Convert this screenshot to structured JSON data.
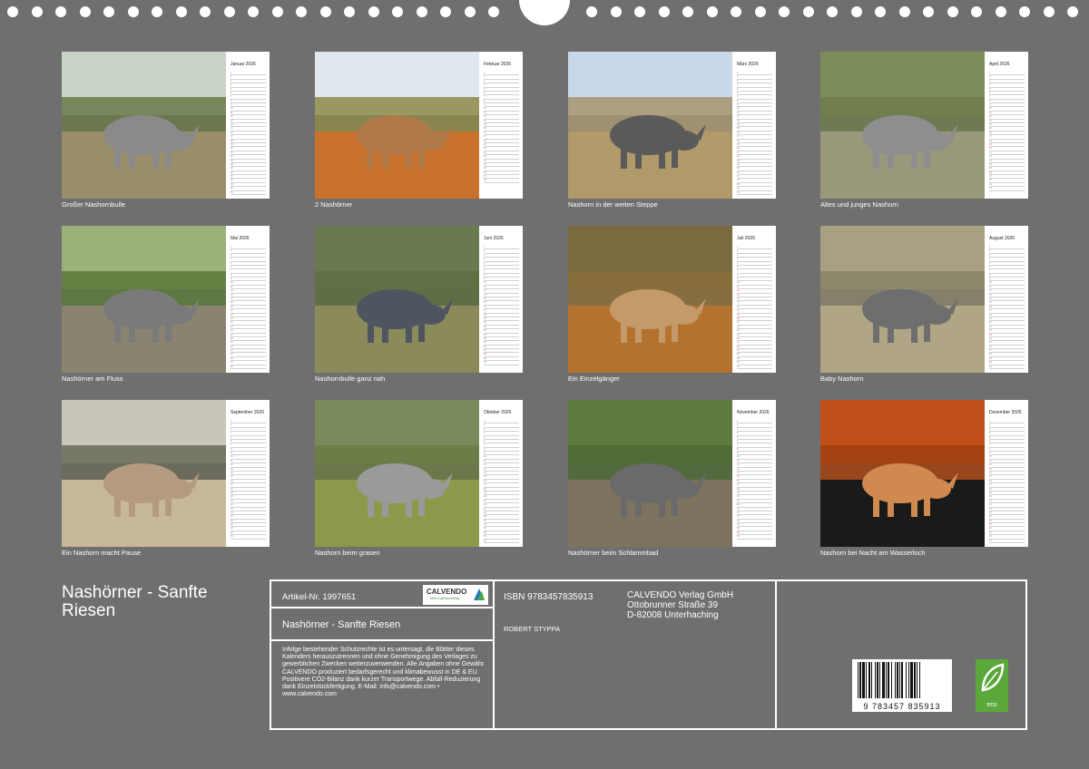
{
  "months": [
    {
      "name": "Januar 2026",
      "caption": "Großer Nashornbulle",
      "days": 31,
      "weekends": [
        4,
        11,
        18,
        25
      ],
      "sky": "#c9d2c6",
      "ground": "#9a8d6a",
      "bg": "#6b7a4a",
      "rhino": "#8a8a8a"
    },
    {
      "name": "Februar 2026",
      "caption": "2 Nashörner",
      "days": 28,
      "weekends": [
        1,
        8,
        15,
        22
      ],
      "sky": "#dfe7ee",
      "ground": "#c9722e",
      "bg": "#8d8a4a",
      "rhino": "#b0794a"
    },
    {
      "name": "März 2026",
      "caption": "Nashorn in der weiten Steppe",
      "days": 31,
      "weekends": [
        1,
        8,
        15,
        22,
        29
      ],
      "sky": "#c9d8e8",
      "ground": "#b09a6a",
      "bg": "#a89670",
      "rhino": "#5a5a5a"
    },
    {
      "name": "April 2026",
      "caption": "Altes und junges Nashorn",
      "days": 30,
      "weekends": [
        5,
        12,
        19,
        26
      ],
      "sky": "#7d8d5a",
      "ground": "#9a987a",
      "bg": "#6e7d4e",
      "rhino": "#8e8e8e"
    },
    {
      "name": "Mai 2026",
      "caption": "Nashörner am Fluss",
      "days": 31,
      "weekends": [
        3,
        10,
        17,
        24,
        31
      ],
      "sky": "#9cb07a",
      "ground": "#8a8370",
      "bg": "#5a7a3a",
      "rhino": "#7a7a7a"
    },
    {
      "name": "Juni 2026",
      "caption": "Nashornbulle ganz nah",
      "days": 30,
      "weekends": [
        7,
        14,
        21,
        28
      ],
      "sky": "#6a7a50",
      "ground": "#8a8a5a",
      "bg": "#5e6e42",
      "rhino": "#4e5560"
    },
    {
      "name": "Juli 2026",
      "caption": "Ein Einzelgänger",
      "days": 31,
      "weekends": [
        5,
        12,
        19,
        26
      ],
      "sky": "#7a6a40",
      "ground": "#b4722e",
      "bg": "#8a6e3a",
      "rhino": "#c49a6a"
    },
    {
      "name": "August 2026",
      "caption": "Baby Nashorn",
      "days": 31,
      "weekends": [
        2,
        9,
        16,
        23,
        30
      ],
      "sky": "#a8a082",
      "ground": "#b0a584",
      "bg": "#8a8468",
      "rhino": "#6e6e6e"
    },
    {
      "name": "September 2026",
      "caption": "Ein Nashorn macht Pause",
      "days": 30,
      "weekends": [
        6,
        13,
        20,
        27
      ],
      "sky": "#c8c6b8",
      "ground": "#c8b89a",
      "bg": "#6a6a5a",
      "rhino": "#b49a80"
    },
    {
      "name": "Oktober 2026",
      "caption": "Nashorn beim grasen",
      "days": 31,
      "weekends": [
        4,
        11,
        18,
        25
      ],
      "sky": "#7a8a5a",
      "ground": "#8a9a4a",
      "bg": "#6a7a44",
      "rhino": "#9a9a9a"
    },
    {
      "name": "November 2026",
      "caption": "Nashörner beim Schlammbad",
      "days": 30,
      "weekends": [
        1,
        8,
        15,
        22,
        29
      ],
      "sky": "#5e7a3e",
      "ground": "#7e735e",
      "bg": "#4e6a36",
      "rhino": "#6a6a6a"
    },
    {
      "name": "Dezember 2026",
      "caption": "Nashorn bei Nacht am Wasserloch",
      "days": 31,
      "weekends": [
        6,
        13,
        20,
        27
      ],
      "sky": "#c0501a",
      "ground": "#1a1a1a",
      "bg": "#a04010",
      "rhino": "#d08a50"
    }
  ],
  "cover": {
    "title": "Nashörner - Sanfte Riesen"
  },
  "info": {
    "article": "Artikel-Nr. 1997651",
    "calvendo_logo_text": "CALVENDO",
    "calvendo_logo_sub": "Mein Kalenderverlag",
    "book_title": "Nashörner - Sanfte Riesen",
    "legal": "Infolge bestehender Schutzrechte ist es untersagt, die Blätter dieses Kalenders herauszutrennen und ohne Genehmigung des Verlages zu gewerblichen Zwecken weiterzuverwenden. Alle Angaben ohne Gewähr. CALVENDO produziert bedarfsgerecht und klimabewusst in DE & EU. Positivere CO2-Bilanz dank kurzer Transportwege. Abfall-Reduzierung dank Einzelstückfertigung. E-Mail: info@calvendo.com • www.calvendo.com",
    "isbn": "ISBN 9783457835913",
    "author": "ROBERT STYPPA",
    "publisher_line1": "CALVENDO Verlag GmbH",
    "publisher_line2": "Ottobrunner Straße 39",
    "publisher_line3": "D-82008 Unterhaching",
    "barcode_digits": "9  783457  835913",
    "eco_label": "eco"
  },
  "colors": {
    "background": "#6f6f6f",
    "paper": "#ffffff",
    "weekend_red": "#d94a3a",
    "holiday_green": "#3a9a4a",
    "eco_green": "#5aa83a"
  }
}
